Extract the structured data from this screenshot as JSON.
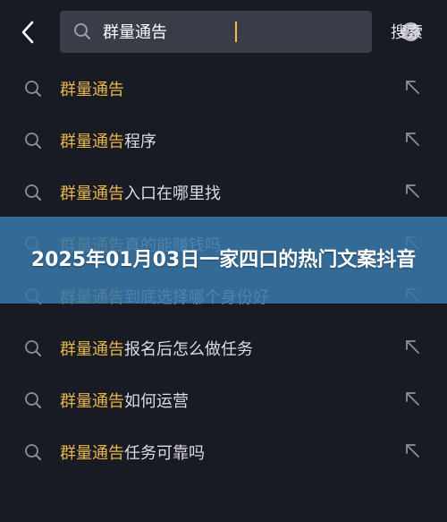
{
  "search": {
    "query": "群量通告",
    "button_label": "搜索"
  },
  "suggestions": [
    {
      "highlight": "群量通告",
      "rest": ""
    },
    {
      "highlight": "群量通告",
      "rest": "程序"
    },
    {
      "highlight": "群量通告",
      "rest": "入口在哪里找"
    },
    {
      "highlight": "群量通告",
      "rest": "真的能赚钱吗"
    },
    {
      "highlight": "群量通告",
      "rest": "到底选择哪个身份好"
    },
    {
      "highlight": "群量通告",
      "rest": "报名后怎么做任务"
    },
    {
      "highlight": "群量通告",
      "rest": "如何运营"
    },
    {
      "highlight": "群量通告",
      "rest": "任务可靠吗"
    }
  ],
  "banner": {
    "text": "2025年01月03日一家四口的热门文案抖音"
  },
  "colors": {
    "background": "#181a24",
    "highlight": "#e7b649",
    "banner": "#3876a6"
  },
  "icons": {
    "back": "chevron-left-icon",
    "search": "search-icon",
    "clear": "clear-icon",
    "fill": "arrow-up-left-icon"
  }
}
